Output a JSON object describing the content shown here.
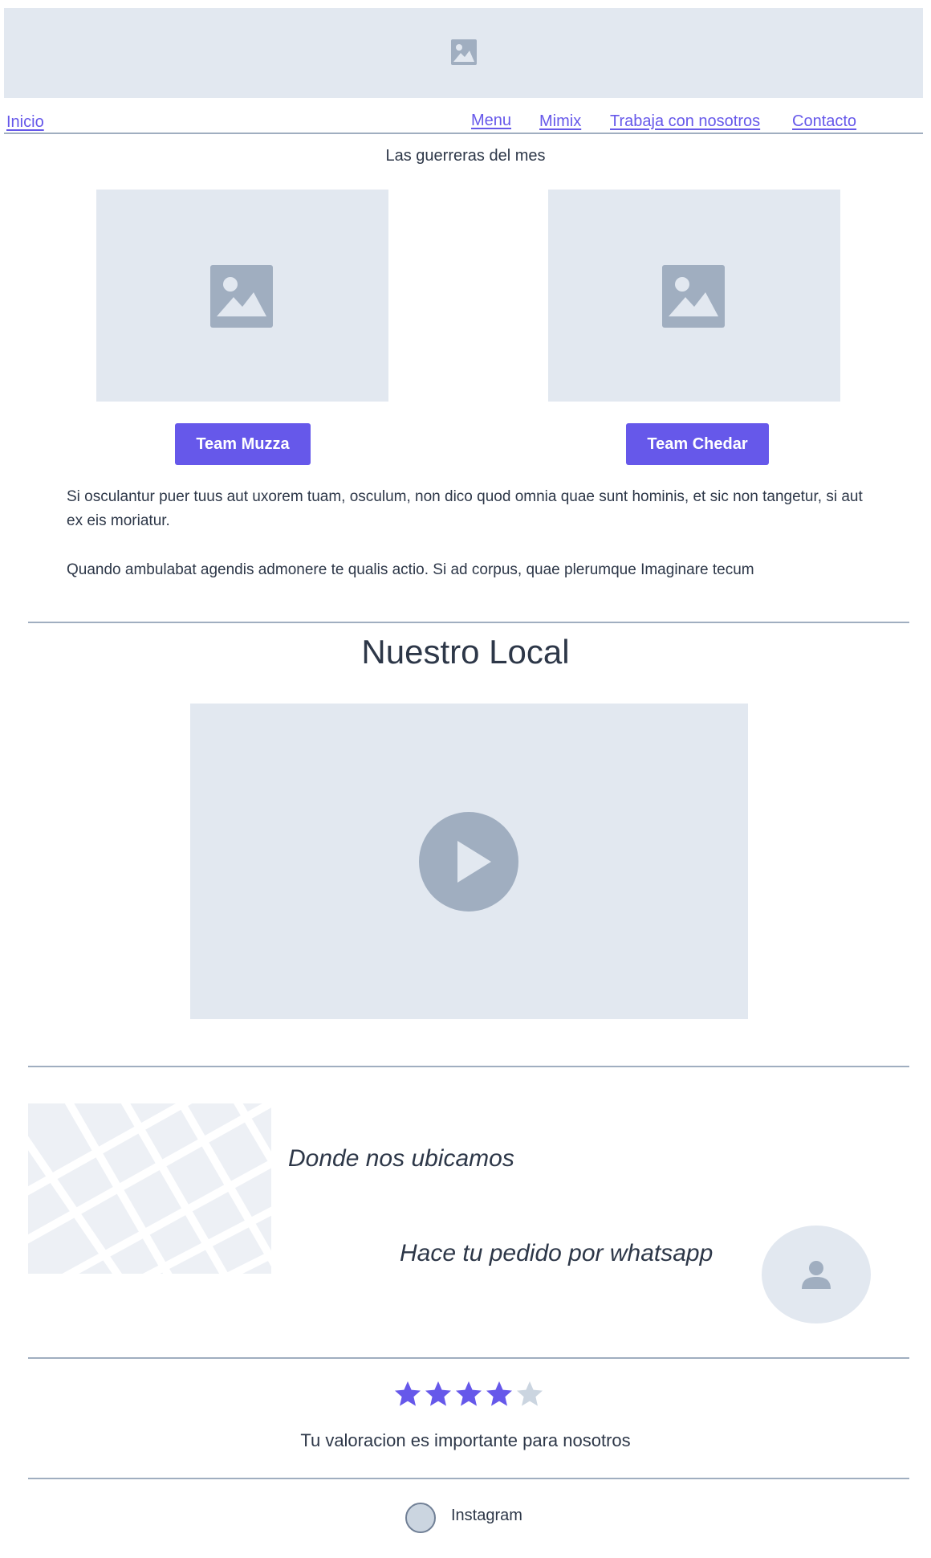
{
  "nav": {
    "home": "Inicio",
    "menu": "Menu",
    "mimix": "Mimix",
    "jobs": "Trabaja con nosotros",
    "contact": "Contacto"
  },
  "featured": {
    "title": "Las guerreras del mes",
    "button_1": "Team Muzza",
    "button_2": "Team Chedar"
  },
  "intro": {
    "paragraph_1": "Si osculantur puer tuus aut uxorem tuam, osculum, non dico quod omnia quae sunt hominis, et sic non tangetur, si aut ex eis moriatur.",
    "paragraph_2": "Quando ambulabat agendis admonere te qualis actio. Si ad corpus, quae plerumque Imaginare tecum"
  },
  "local": {
    "title": "Nuestro Local"
  },
  "location": {
    "text": "Donde nos ubicamos",
    "whatsapp_text": "Hace tu pedido por whatsapp"
  },
  "rating": {
    "value": 4,
    "max": 5,
    "text": "Tu valoracion es importante para nosotros"
  },
  "social": {
    "instagram": "Instagram"
  },
  "colors": {
    "accent": "#6658ea",
    "placeholder_bg": "#e2e8f0",
    "placeholder_icon": "#a0aec0",
    "divider": "#a0aec0",
    "star_empty": "#cbd5e0"
  },
  "icons": {
    "banner": "image-icon",
    "cards": "image-icon",
    "video": "play-icon",
    "avatar": "user-icon",
    "rating": "star-icon"
  }
}
